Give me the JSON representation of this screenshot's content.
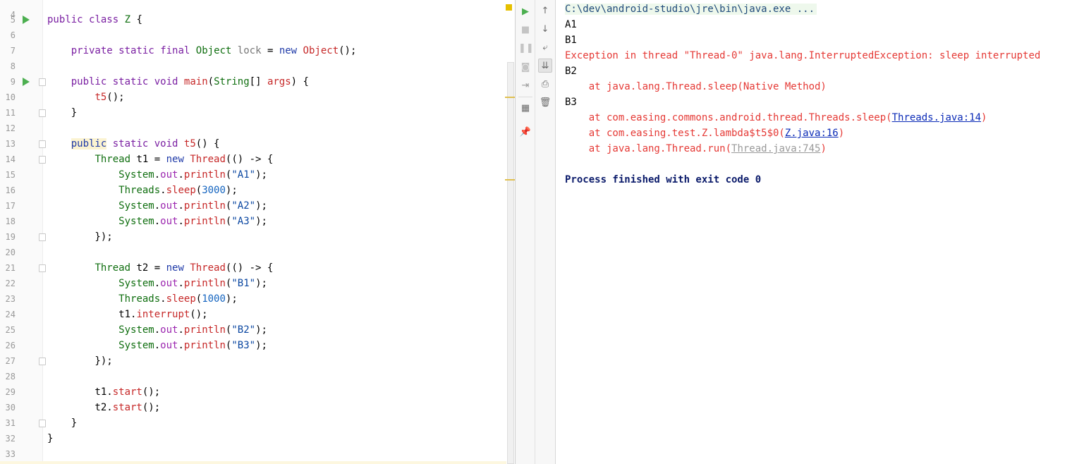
{
  "editor": {
    "partial_top_line_number": "4",
    "lines": [
      {
        "n": "5",
        "run": true,
        "fold": false,
        "tokens": [
          [
            "kw",
            "public"
          ],
          [
            "def",
            " "
          ],
          [
            "kw",
            "class"
          ],
          [
            "def",
            " "
          ],
          [
            "ty",
            "Z"
          ],
          [
            "def",
            " {"
          ]
        ]
      },
      {
        "n": "6",
        "run": false,
        "fold": false,
        "tokens": []
      },
      {
        "n": "7",
        "run": false,
        "fold": false,
        "tokens": [
          [
            "def",
            "    "
          ],
          [
            "kw",
            "private"
          ],
          [
            "def",
            " "
          ],
          [
            "kw",
            "static"
          ],
          [
            "def",
            " "
          ],
          [
            "kw",
            "final"
          ],
          [
            "def",
            " "
          ],
          [
            "ty",
            "Object"
          ],
          [
            "def",
            " "
          ],
          [
            "gray",
            "lock"
          ],
          [
            "def",
            " = "
          ],
          [
            "kw2",
            "new"
          ],
          [
            "def",
            " "
          ],
          [
            "fn",
            "Object"
          ],
          [
            "def",
            "();"
          ]
        ]
      },
      {
        "n": "8",
        "run": false,
        "fold": false,
        "tokens": []
      },
      {
        "n": "9",
        "run": true,
        "fold": true,
        "tokens": [
          [
            "def",
            "    "
          ],
          [
            "kw",
            "public"
          ],
          [
            "def",
            " "
          ],
          [
            "kw",
            "static"
          ],
          [
            "def",
            " "
          ],
          [
            "kw",
            "void"
          ],
          [
            "def",
            " "
          ],
          [
            "fn",
            "main"
          ],
          [
            "def",
            "("
          ],
          [
            "ty",
            "String"
          ],
          [
            "def",
            "[] "
          ],
          [
            "fn",
            "args"
          ],
          [
            "def",
            ") {"
          ]
        ]
      },
      {
        "n": "10",
        "run": false,
        "fold": false,
        "tokens": [
          [
            "def",
            "        "
          ],
          [
            "fn",
            "t5"
          ],
          [
            "def",
            "();"
          ]
        ]
      },
      {
        "n": "11",
        "run": false,
        "fold": true,
        "tokens": [
          [
            "def",
            "    }"
          ]
        ]
      },
      {
        "n": "12",
        "run": false,
        "fold": false,
        "tokens": []
      },
      {
        "n": "13",
        "run": false,
        "fold": true,
        "tokens": [
          [
            "def",
            "    "
          ],
          [
            "hlkw",
            "public"
          ],
          [
            "def",
            " "
          ],
          [
            "kw",
            "static"
          ],
          [
            "def",
            " "
          ],
          [
            "kw",
            "void"
          ],
          [
            "def",
            " "
          ],
          [
            "fn",
            "t5"
          ],
          [
            "def",
            "() {"
          ]
        ]
      },
      {
        "n": "14",
        "run": false,
        "fold": true,
        "tokens": [
          [
            "def",
            "        "
          ],
          [
            "ty",
            "Thread"
          ],
          [
            "def",
            " t1 = "
          ],
          [
            "kw2",
            "new"
          ],
          [
            "def",
            " "
          ],
          [
            "fn",
            "Thread"
          ],
          [
            "def",
            "(() -> {"
          ]
        ]
      },
      {
        "n": "15",
        "run": false,
        "fold": false,
        "tokens": [
          [
            "def",
            "            "
          ],
          [
            "ty",
            "System"
          ],
          [
            "def",
            "."
          ],
          [
            "fld",
            "out"
          ],
          [
            "def",
            "."
          ],
          [
            "fn",
            "println"
          ],
          [
            "def",
            "("
          ],
          [
            "str",
            "\"A1\""
          ],
          [
            "def",
            ");"
          ]
        ]
      },
      {
        "n": "16",
        "run": false,
        "fold": false,
        "tokens": [
          [
            "def",
            "            "
          ],
          [
            "ty",
            "Threads"
          ],
          [
            "def",
            "."
          ],
          [
            "fn",
            "sleep"
          ],
          [
            "def",
            "("
          ],
          [
            "num",
            "3000"
          ],
          [
            "def",
            ");"
          ]
        ]
      },
      {
        "n": "17",
        "run": false,
        "fold": false,
        "tokens": [
          [
            "def",
            "            "
          ],
          [
            "ty",
            "System"
          ],
          [
            "def",
            "."
          ],
          [
            "fld",
            "out"
          ],
          [
            "def",
            "."
          ],
          [
            "fn",
            "println"
          ],
          [
            "def",
            "("
          ],
          [
            "str",
            "\"A2\""
          ],
          [
            "def",
            ");"
          ]
        ]
      },
      {
        "n": "18",
        "run": false,
        "fold": false,
        "tokens": [
          [
            "def",
            "            "
          ],
          [
            "ty",
            "System"
          ],
          [
            "def",
            "."
          ],
          [
            "fld",
            "out"
          ],
          [
            "def",
            "."
          ],
          [
            "fn",
            "println"
          ],
          [
            "def",
            "("
          ],
          [
            "str",
            "\"A3\""
          ],
          [
            "def",
            ");"
          ]
        ]
      },
      {
        "n": "19",
        "run": false,
        "fold": true,
        "tokens": [
          [
            "def",
            "        });"
          ]
        ]
      },
      {
        "n": "20",
        "run": false,
        "fold": false,
        "tokens": []
      },
      {
        "n": "21",
        "run": false,
        "fold": true,
        "tokens": [
          [
            "def",
            "        "
          ],
          [
            "ty",
            "Thread"
          ],
          [
            "def",
            " t2 = "
          ],
          [
            "kw2",
            "new"
          ],
          [
            "def",
            " "
          ],
          [
            "fn",
            "Thread"
          ],
          [
            "def",
            "(() -> {"
          ]
        ]
      },
      {
        "n": "22",
        "run": false,
        "fold": false,
        "tokens": [
          [
            "def",
            "            "
          ],
          [
            "ty",
            "System"
          ],
          [
            "def",
            "."
          ],
          [
            "fld",
            "out"
          ],
          [
            "def",
            "."
          ],
          [
            "fn",
            "println"
          ],
          [
            "def",
            "("
          ],
          [
            "str",
            "\"B1\""
          ],
          [
            "def",
            ");"
          ]
        ]
      },
      {
        "n": "23",
        "run": false,
        "fold": false,
        "tokens": [
          [
            "def",
            "            "
          ],
          [
            "ty",
            "Threads"
          ],
          [
            "def",
            "."
          ],
          [
            "fn",
            "sleep"
          ],
          [
            "def",
            "("
          ],
          [
            "num",
            "1000"
          ],
          [
            "def",
            ");"
          ]
        ]
      },
      {
        "n": "24",
        "run": false,
        "fold": false,
        "tokens": [
          [
            "def",
            "            t1."
          ],
          [
            "fn",
            "interrupt"
          ],
          [
            "def",
            "();"
          ]
        ]
      },
      {
        "n": "25",
        "run": false,
        "fold": false,
        "tokens": [
          [
            "def",
            "            "
          ],
          [
            "ty",
            "System"
          ],
          [
            "def",
            "."
          ],
          [
            "fld",
            "out"
          ],
          [
            "def",
            "."
          ],
          [
            "fn",
            "println"
          ],
          [
            "def",
            "("
          ],
          [
            "str",
            "\"B2\""
          ],
          [
            "def",
            ");"
          ]
        ]
      },
      {
        "n": "26",
        "run": false,
        "fold": false,
        "tokens": [
          [
            "def",
            "            "
          ],
          [
            "ty",
            "System"
          ],
          [
            "def",
            "."
          ],
          [
            "fld",
            "out"
          ],
          [
            "def",
            "."
          ],
          [
            "fn",
            "println"
          ],
          [
            "def",
            "("
          ],
          [
            "str",
            "\"B3\""
          ],
          [
            "def",
            ");"
          ]
        ]
      },
      {
        "n": "27",
        "run": false,
        "fold": true,
        "tokens": [
          [
            "def",
            "        });"
          ]
        ]
      },
      {
        "n": "28",
        "run": false,
        "fold": false,
        "tokens": []
      },
      {
        "n": "29",
        "run": false,
        "fold": false,
        "tokens": [
          [
            "def",
            "        t1."
          ],
          [
            "fn",
            "start"
          ],
          [
            "def",
            "();"
          ]
        ]
      },
      {
        "n": "30",
        "run": false,
        "fold": false,
        "tokens": [
          [
            "def",
            "        t2."
          ],
          [
            "fn",
            "start"
          ],
          [
            "def",
            "();"
          ]
        ]
      },
      {
        "n": "31",
        "run": false,
        "fold": true,
        "tokens": [
          [
            "def",
            "    }"
          ]
        ]
      },
      {
        "n": "32",
        "run": false,
        "fold": false,
        "tokens": [
          [
            "def",
            "}"
          ]
        ]
      },
      {
        "n": "33",
        "run": false,
        "fold": false,
        "tokens": []
      }
    ]
  },
  "run_toolbar": {
    "left": [
      {
        "icon": "rerun-icon",
        "glyph": "▶",
        "color": "#4caf50",
        "label": "Rerun"
      },
      {
        "icon": "stop-icon",
        "glyph": "■",
        "color": "#c4c4c4",
        "label": "Stop"
      },
      {
        "icon": "pause-icon",
        "glyph": "❚❚",
        "color": "#c4c4c4",
        "label": "Pause"
      },
      {
        "icon": "camera-icon",
        "glyph": "◙",
        "color": "#c4c4c4",
        "label": "Dump threads"
      },
      {
        "icon": "exit-icon",
        "glyph": "⇥",
        "color": "#9a9a9a",
        "label": "Exit"
      },
      {
        "icon": "layout-icon",
        "glyph": "▦",
        "color": "#6a6a6a",
        "label": "Restore layout"
      },
      {
        "icon": "pin-icon",
        "glyph": "📌",
        "color": "#6a6a6a",
        "label": "Pin tab"
      }
    ],
    "right": [
      {
        "icon": "up-arrow-icon",
        "glyph": "↑",
        "label": "Up the stack trace",
        "selected": false
      },
      {
        "icon": "down-arrow-icon",
        "glyph": "↓",
        "label": "Down the stack trace",
        "selected": false
      },
      {
        "icon": "soft-wrap-icon",
        "glyph": "⤶",
        "label": "Soft-wrap",
        "selected": false
      },
      {
        "icon": "scroll-to-end-icon",
        "glyph": "⇊",
        "label": "Scroll to end",
        "selected": true
      },
      {
        "icon": "print-icon",
        "glyph": "⎙",
        "label": "Print",
        "selected": false
      },
      {
        "icon": "trash-icon",
        "glyph": "🗑",
        "label": "Clear all",
        "selected": false
      }
    ]
  },
  "console": {
    "lines": [
      {
        "type": "cmd",
        "text": "C:\\dev\\android-studio\\jre\\bin\\java.exe ..."
      },
      {
        "type": "out",
        "text": "A1"
      },
      {
        "type": "out",
        "text": "B1"
      },
      {
        "type": "err",
        "text": "Exception in thread \"Thread-0\" java.lang.InterruptedException: sleep interrupted"
      },
      {
        "type": "out",
        "text": "B2"
      },
      {
        "type": "trace",
        "prefix": "    at java.lang.Thread.sleep(Native Method)",
        "link": "",
        "suffix": "",
        "linkStyle": ""
      },
      {
        "type": "out",
        "text": "B3"
      },
      {
        "type": "trace",
        "prefix": "    at com.easing.commons.android.thread.Threads.sleep(",
        "link": "Threads.java:14",
        "suffix": ")",
        "linkStyle": "lnk"
      },
      {
        "type": "trace",
        "prefix": "    at com.easing.test.Z.lambda$t5$0(",
        "link": "Z.java:16",
        "suffix": ")",
        "linkStyle": "lnk"
      },
      {
        "type": "trace",
        "prefix": "    at java.lang.Thread.run(",
        "link": "Thread.java:745",
        "suffix": ")",
        "linkStyle": "lnkgray"
      },
      {
        "type": "blank",
        "text": ""
      },
      {
        "type": "proc",
        "text": "Process finished with exit code 0"
      }
    ]
  }
}
